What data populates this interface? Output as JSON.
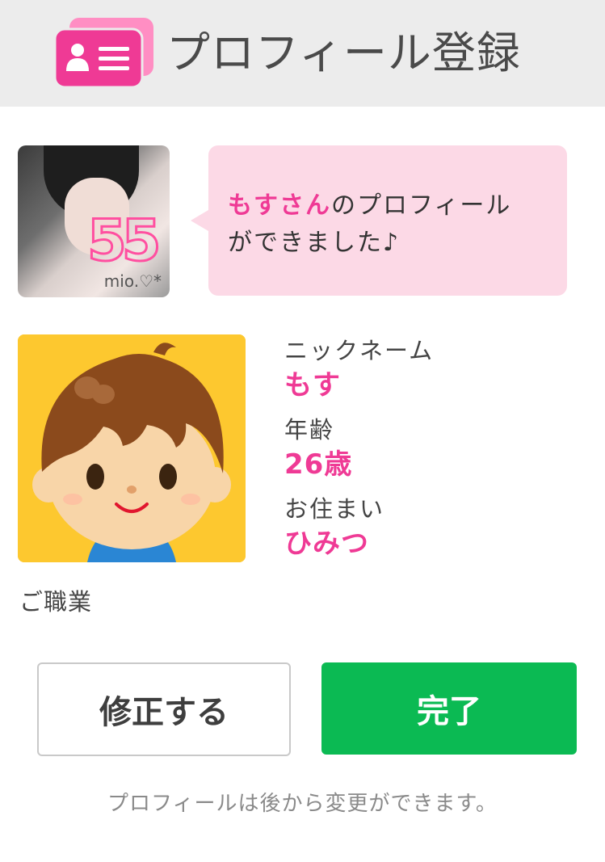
{
  "header": {
    "title": "プロフィール登録",
    "icon": "profile-card-icon"
  },
  "photo": {
    "caption": "mio.♡*",
    "deco_text": "55"
  },
  "bubble": {
    "name": "もすさん",
    "line1_rest": "のプロフィール",
    "line2": "ができました♪"
  },
  "profile": {
    "nickname_label": "ニックネーム",
    "nickname_value": "もす",
    "age_label": "年齢",
    "age_value": "26歳",
    "residence_label": "お住まい",
    "residence_value": "ひみつ",
    "occupation_label": "ご職業"
  },
  "buttons": {
    "edit_label": "修正する",
    "done_label": "完了"
  },
  "footer": {
    "note": "プロフィールは後から変更ができます。"
  },
  "colors": {
    "accent_pink": "#ef3a95",
    "bubble_pink": "#fcd9e6",
    "done_green": "#0bba53",
    "header_bg": "#ececec"
  }
}
